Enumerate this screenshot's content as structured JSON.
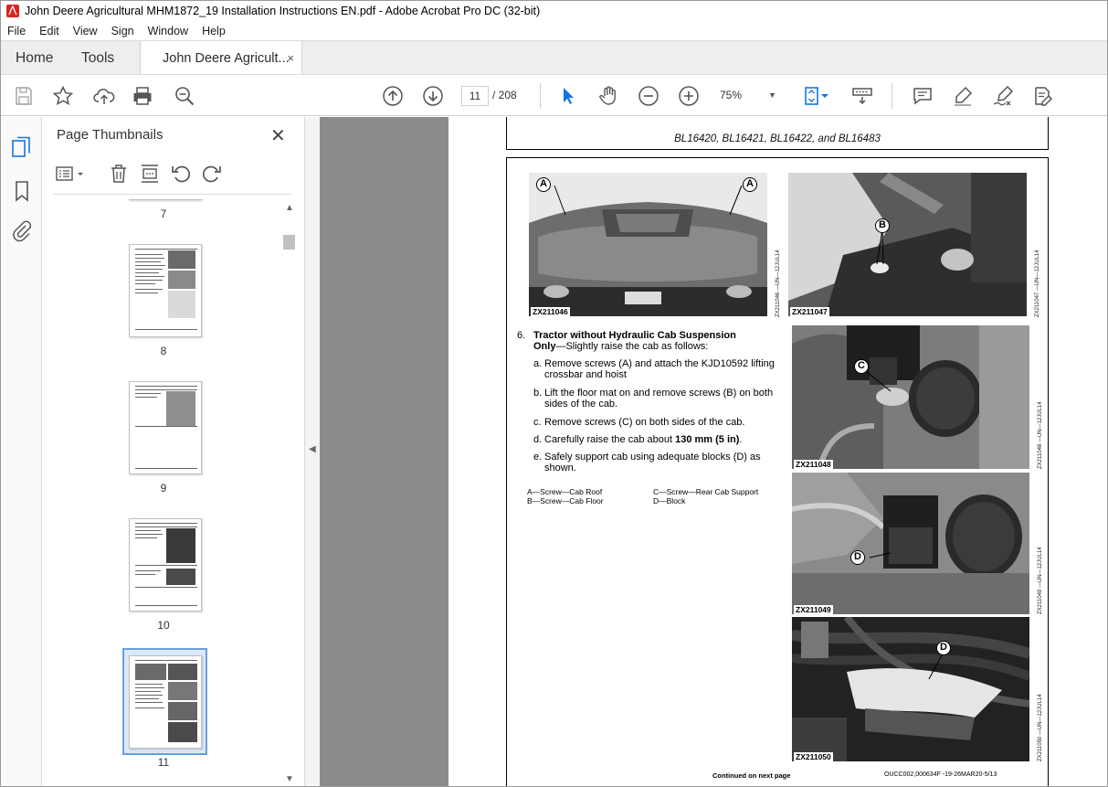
{
  "window": {
    "title": "John Deere Agricultural MHM1872_19 Installation Instructions EN.pdf - Adobe Acrobat Pro DC (32-bit)"
  },
  "menu": [
    "File",
    "Edit",
    "View",
    "Sign",
    "Window",
    "Help"
  ],
  "tabs": {
    "home": "Home",
    "tools": "Tools",
    "document": "John Deere Agricult...",
    "close": "×"
  },
  "toolbar": {
    "current_page": "11",
    "page_total": "/ 208",
    "zoom": "75%"
  },
  "thumbnails": {
    "title": "Page Thumbnails",
    "close": "✕",
    "pages": [
      "7",
      "8",
      "9",
      "10",
      "11"
    ],
    "selected": "11"
  },
  "document": {
    "header": "BL16420, BL16421, BL16422, and BL16483",
    "photos": {
      "p1": "ZX211046",
      "p2": "ZX211047",
      "p3": "ZX211048",
      "p4": "ZX211049",
      "p5": "ZX211050"
    },
    "side_captions": {
      "p1": "ZX211046 —UN—12JUL14",
      "p2": "ZX211047 —UN—12JUL14",
      "p3": "ZX211048 —UN—12JUL14",
      "p4": "ZX211049 —UN—12JUL14",
      "p5": "ZX211050 —UN—12JUL14"
    },
    "callouts": {
      "a": "A",
      "b": "B",
      "c": "C",
      "d": "D"
    },
    "step_number": "6.",
    "step_title_1": "Tractor without Hydraulic Cab Suspension",
    "step_title_2": "Only",
    "step_intro": "—Slightly raise the cab as follows:",
    "substeps": [
      {
        "label": "a.",
        "text_1": "Remove screws (A) and attach the KJD10592 lifting",
        "text_2": "crossbar and hoist"
      },
      {
        "label": "b.",
        "text_1": "Lift the floor mat on and remove screws (B) on both",
        "text_2": "sides of the cab."
      },
      {
        "label": "c.",
        "text_1": "Remove screws (C) on both sides of the cab.",
        "text_2": ""
      },
      {
        "label": "d.",
        "text_1": "Carefully raise the cab about ",
        "bold": "130 mm (5 in)",
        "text_2": "."
      },
      {
        "label": "e.",
        "text_1": "Safely support cab using adequate blocks (D) as",
        "text_2": "shown."
      }
    ],
    "legend": {
      "a": "A—Screw—Cab Roof",
      "b": "B—Screw—Cab Floor",
      "c": "C—Screw—Rear Cab Support",
      "d": "D—Block"
    },
    "footer_left": "Continued on next page",
    "footer_right": "OUCC002,000634F -19-26MAR20-5/13"
  }
}
